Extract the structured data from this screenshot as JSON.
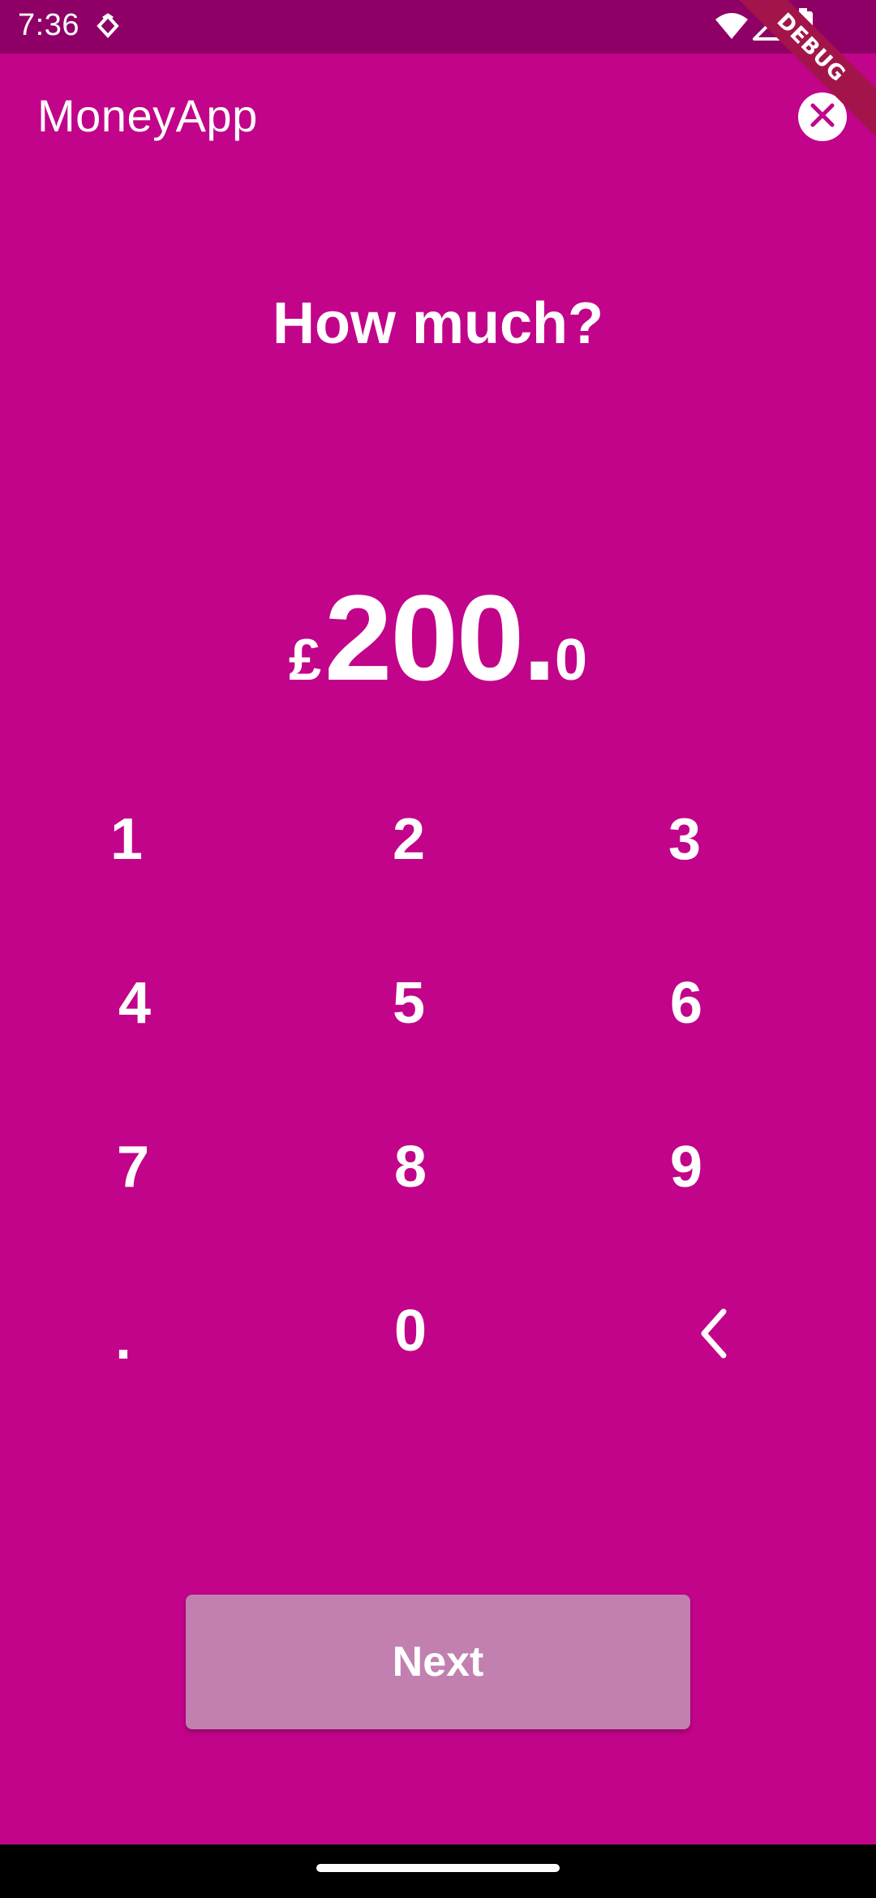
{
  "status_bar": {
    "time": "7:36",
    "icons": [
      "notification-icon",
      "wifi-icon",
      "cellular-signal-icon",
      "battery-icon"
    ]
  },
  "debug_banner": "DEBUG",
  "app_bar": {
    "title": "MoneyApp",
    "close_icon": "close-icon"
  },
  "heading": "How much?",
  "amount": {
    "currency": "£",
    "whole": "200.",
    "decimal": "0"
  },
  "keypad": {
    "keys": [
      "1",
      "2",
      "3",
      "4",
      "5",
      "6",
      "7",
      "8",
      "9",
      ".",
      "0"
    ],
    "backspace_icon": "chevron-left-icon"
  },
  "next_button": {
    "label": "Next",
    "enabled": false
  },
  "colors": {
    "background": "#C1048A",
    "status_bar": "#8E0066",
    "button_disabled": "#C280B0",
    "text": "#FFFFFF",
    "debug_ribbon": "#A3154A"
  }
}
